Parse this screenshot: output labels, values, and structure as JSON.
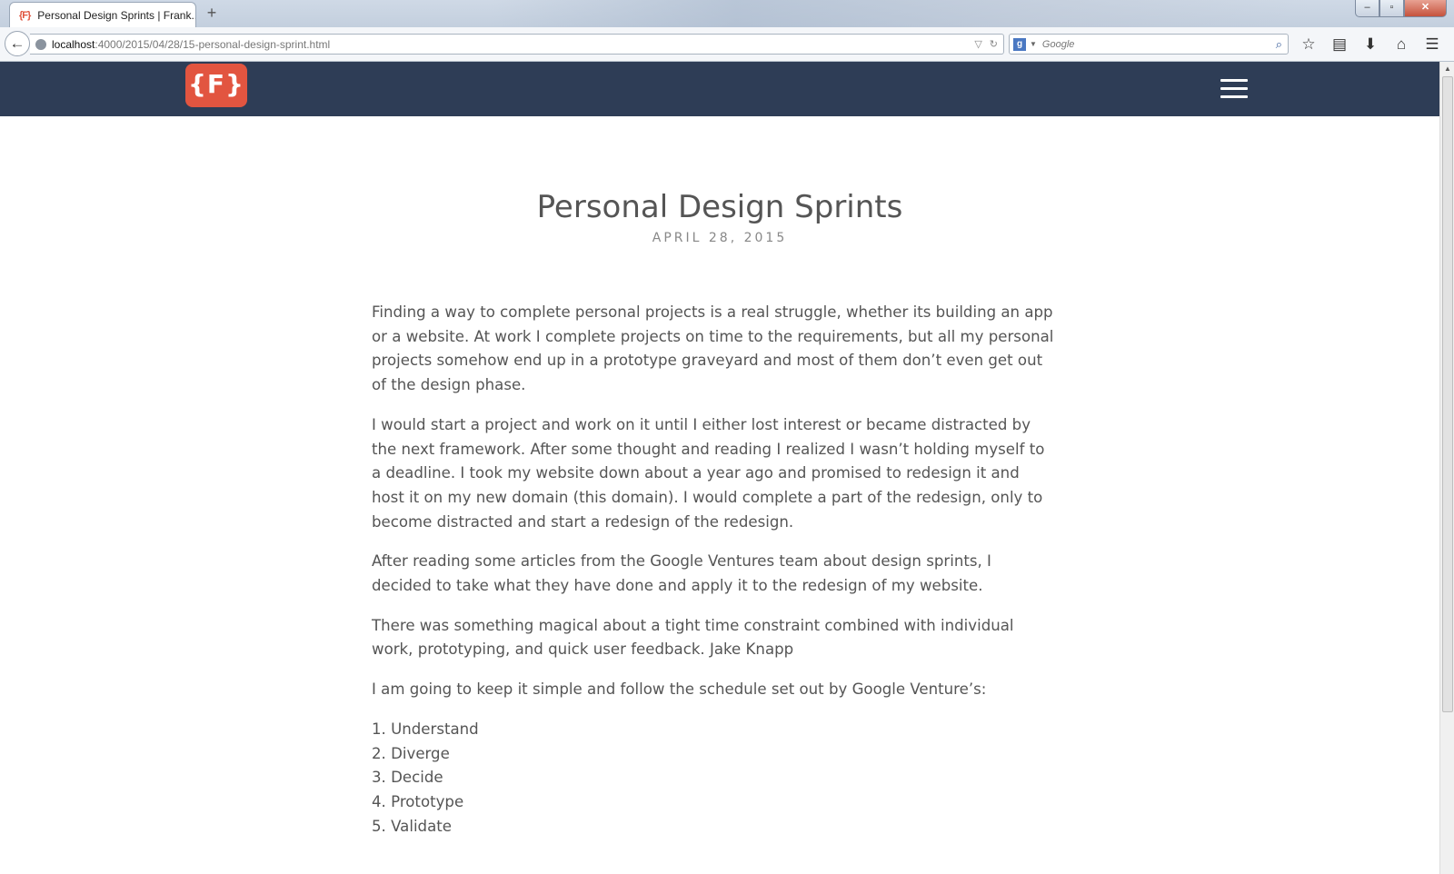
{
  "browser": {
    "tab_title": "Personal Design Sprints | Frank...",
    "tab_favicon": "{F}",
    "new_tab": "+",
    "url_host": "localhost",
    "url_path": ":4000/2015/04/28/15-personal-design-sprint.html",
    "search_placeholder": "Google",
    "search_engine_badge": "g",
    "window_buttons": [
      "–",
      "▫",
      "✕"
    ],
    "back_icon": "←",
    "toolbar_icons": [
      "star-icon",
      "reading-list-icon",
      "download-icon",
      "home-icon",
      "menu-icon"
    ]
  },
  "site": {
    "logo_text": "{F}",
    "header_color": "#2e3d56",
    "logo_color": "#e25540"
  },
  "post": {
    "title": "Personal Design Sprints",
    "date": "APRIL 28, 2015",
    "paragraphs": [
      "Finding a way to complete personal projects is a real struggle, whether its building an app or a website. At work I complete projects on time to the requirements, but all my personal projects somehow end up in a prototype graveyard and most of them don’t even get out of the design phase.",
      "I would start a project and work on it until I either lost interest or became distracted by the next framework. After some thought and reading I realized I wasn’t holding myself to a deadline. I took my website down about a year ago and promised to redesign it and host it on my new domain (this domain). I would complete a part of the redesign, only to become distracted and start a redesign of the redesign.",
      "After reading some articles from the Google Ventures team about design sprints, I decided to take what they have done and apply it to the redesign of my website.",
      "There was something magical about a tight time constraint combined with individual work, prototyping, and quick user feedback. Jake Knapp",
      "I am going to keep it simple and follow the schedule set out by Google Venture’s:"
    ],
    "schedule": [
      "1.  Understand",
      "2.  Diverge",
      "3.  Decide",
      "4.  Prototype",
      "5.  Validate"
    ]
  }
}
